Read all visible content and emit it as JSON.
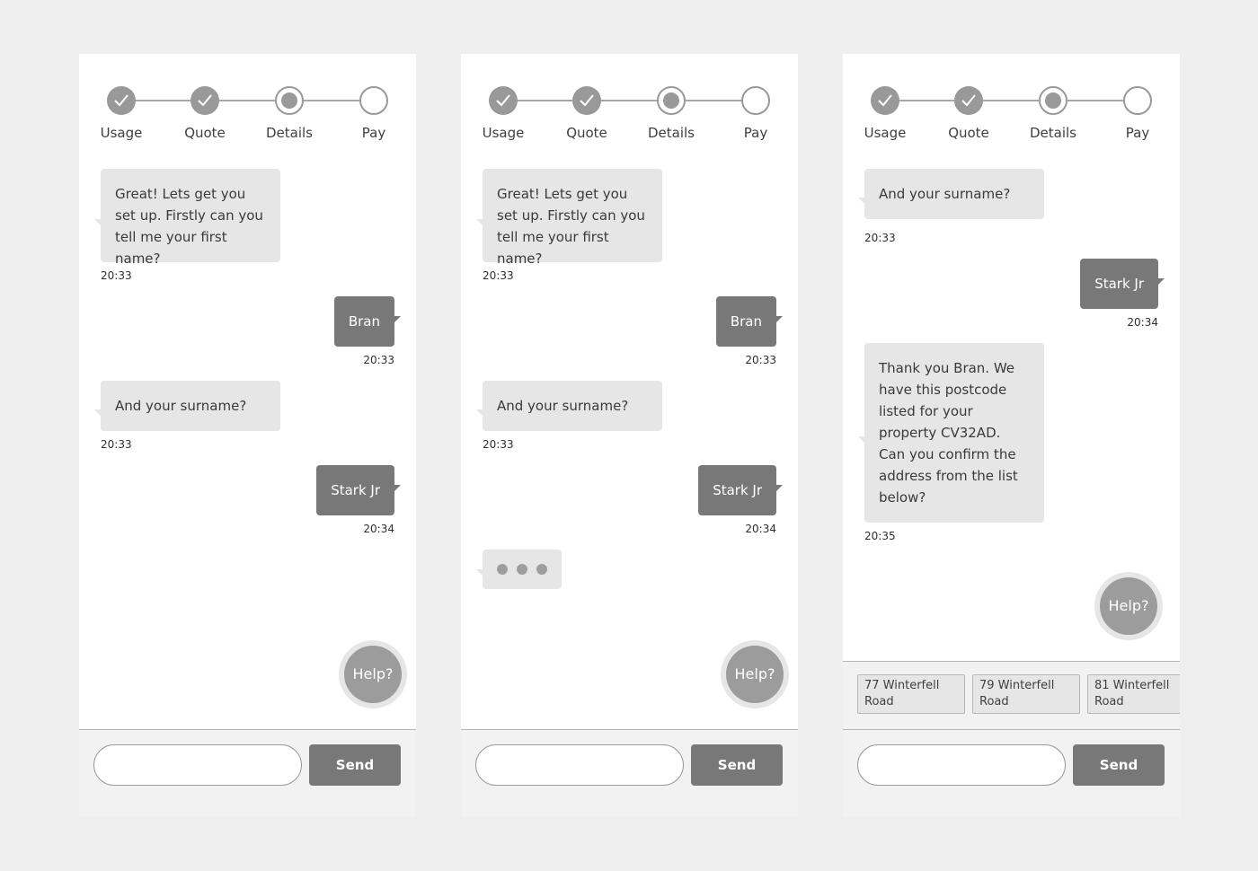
{
  "steps": [
    "Usage",
    "Quote",
    "Details",
    "Pay"
  ],
  "help_label": "Help?",
  "send_label": "Send",
  "input_value": "",
  "screen1": {
    "messages": [
      {
        "sender": "bot",
        "text": "Great! Lets get you set up. Firstly can you tell me your first name?",
        "time": "20:33"
      },
      {
        "sender": "user",
        "text": "Bran",
        "time": "20:33"
      },
      {
        "sender": "bot",
        "text": "And your surname?",
        "time": "20:33"
      },
      {
        "sender": "user",
        "text": "Stark Jr",
        "time": "20:34"
      }
    ]
  },
  "screen2": {
    "messages": [
      {
        "sender": "bot",
        "text": "Great! Lets get you set up. Firstly can you tell me your first name?",
        "time": "20:33"
      },
      {
        "sender": "user",
        "text": "Bran",
        "time": "20:33"
      },
      {
        "sender": "bot",
        "text": "And your surname?",
        "time": "20:33"
      },
      {
        "sender": "user",
        "text": "Stark Jr",
        "time": "20:34"
      }
    ],
    "typing": true
  },
  "screen3": {
    "messages": [
      {
        "sender": "bot",
        "text": "And your surname?",
        "time": "20:33"
      },
      {
        "sender": "user",
        "text": "Stark Jr",
        "time": "20:34"
      },
      {
        "sender": "bot",
        "text": "Thank you Bran. We have this postcode listed  for your property CV32AD. Can you confirm the address from the list below?",
        "time": "20:35"
      }
    ],
    "address_options": [
      "77 Winterfell Road",
      "79 Winterfell Road",
      "81 Winterfell Road"
    ]
  },
  "colors": {
    "background": "#efefef",
    "screen": "#ffffff",
    "bot_bubble": "#e6e6e6",
    "user_bubble": "#787878",
    "step_active": "#999999",
    "send_button": "#787878"
  },
  "icons": {
    "step_done": "check-icon",
    "step_current": "filled-dot-icon",
    "step_todo": "empty-circle-icon"
  }
}
